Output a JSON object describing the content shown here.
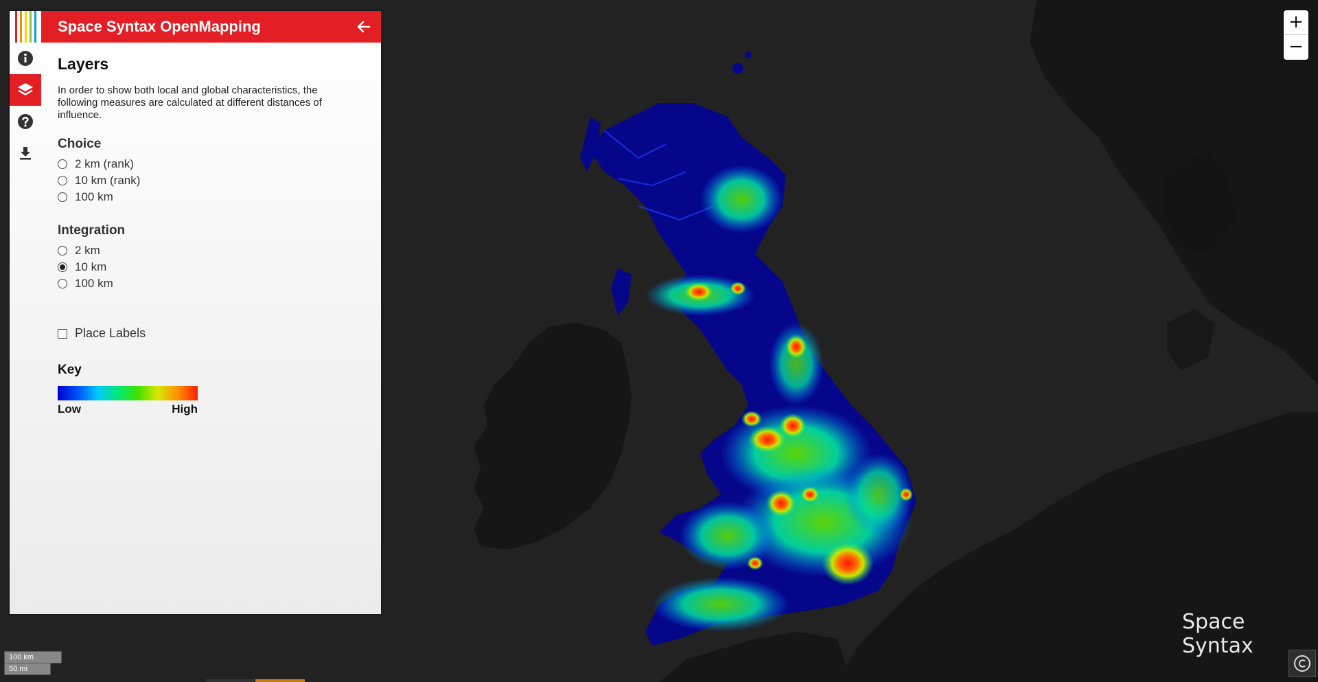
{
  "app": {
    "title": "Space Syntax OpenMapping"
  },
  "sidebar": {
    "tabs": [
      {
        "id": "info",
        "icon": "info-icon"
      },
      {
        "id": "layers",
        "icon": "layers-icon",
        "active": true
      },
      {
        "id": "help",
        "icon": "help-icon"
      },
      {
        "id": "download",
        "icon": "download-icon"
      }
    ]
  },
  "panel": {
    "heading": "Layers",
    "intro": "In order to show both local and global characteristics, the following measures are calculated at different distances of influence.",
    "choice": {
      "title": "Choice",
      "options": [
        "2 km (rank)",
        "10 km (rank)",
        "100 km"
      ],
      "selected": null
    },
    "integration": {
      "title": "Integration",
      "options": [
        "2 km",
        "10 km",
        "100 km"
      ],
      "selected": "10 km"
    },
    "place_labels": {
      "label": "Place Labels",
      "checked": false
    },
    "key": {
      "title": "Key",
      "low": "Low",
      "high": "High"
    }
  },
  "map": {
    "zoom_in": "+",
    "zoom_out": "−",
    "brand": "Space Syntax",
    "scale": {
      "metric": "100 km",
      "imperial": "50 mi"
    },
    "copyright_icon": "copyright-icon"
  },
  "colors": {
    "accent": "#e31e24",
    "background": "#202020",
    "land": "#161616",
    "gradient": [
      "#0000d0",
      "#0050ff",
      "#00c8ff",
      "#00e878",
      "#40e000",
      "#d8e800",
      "#ff9000",
      "#ff2000"
    ],
    "logo_stripes": [
      "#e31e24",
      "#f39200",
      "#ffd400",
      "#8cc63f",
      "#00a0e0"
    ]
  }
}
